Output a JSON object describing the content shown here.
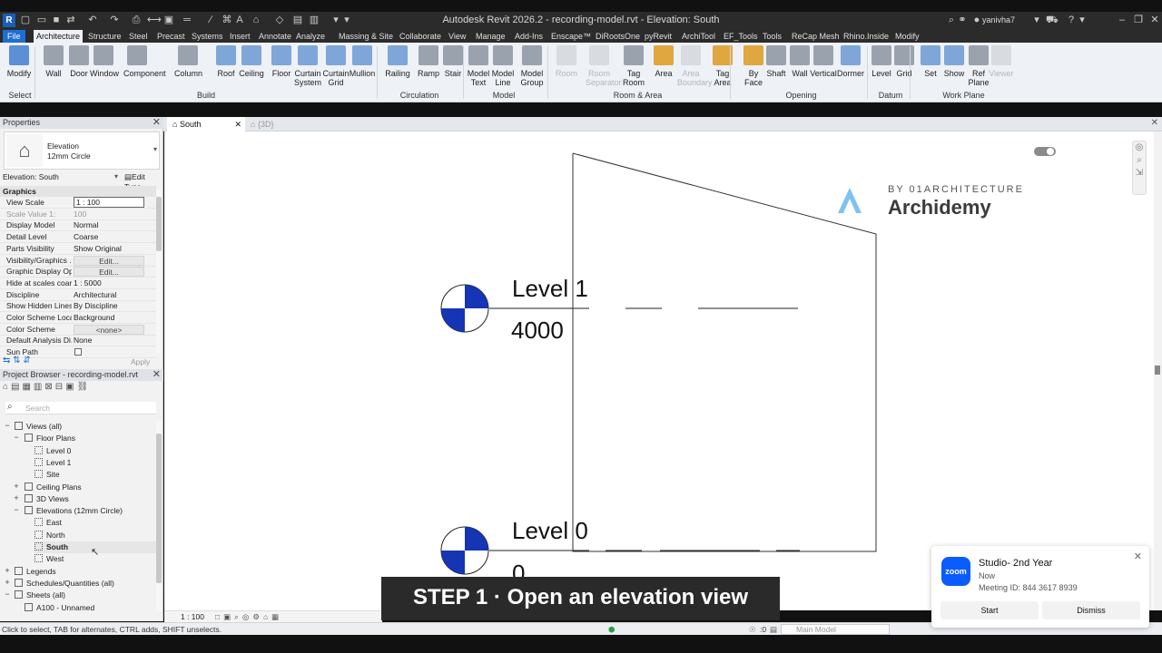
{
  "app": {
    "title": "Autodesk Revit 2026.2 - recording-model.rvt - Elevation: South",
    "user": "yanivha7"
  },
  "menu": [
    "File",
    "Architecture",
    "Structure",
    "Steel",
    "Precast",
    "Systems",
    "Insert",
    "Annotate",
    "Analyze",
    "Massing & Site",
    "Collaborate",
    "View",
    "Manage",
    "Add-Ins",
    "Enscape™",
    "DiRootsOne",
    "pyRevit",
    "ArchiTool",
    "EF_Tools",
    "Tools",
    "ReCap Mesh",
    "Rhino.Inside",
    "Modify"
  ],
  "ribbon": {
    "buttons": [
      {
        "label": "Modify",
        "color": "#5b8fd6"
      },
      {
        "label": "Wall",
        "color": "#9aa2ad"
      },
      {
        "label": "Door",
        "color": "#9aa2ad"
      },
      {
        "label": "Window",
        "color": "#9aa2ad"
      },
      {
        "label": "Component",
        "color": "#9aa2ad"
      },
      {
        "label": "Column",
        "color": "#9aa2ad"
      },
      {
        "label": "Roof",
        "color": "#7fa6d8"
      },
      {
        "label": "Ceiling",
        "color": "#7fa6d8"
      },
      {
        "label": "Floor",
        "color": "#7fa6d8"
      },
      {
        "label": "Curtain\nSystem",
        "color": "#7fa6d8"
      },
      {
        "label": "Curtain\nGrid",
        "color": "#7fa6d8"
      },
      {
        "label": "Mullion",
        "color": "#7fa6d8"
      },
      {
        "label": "Railing",
        "color": "#7fa6d8"
      },
      {
        "label": "Ramp",
        "color": "#9aa2ad"
      },
      {
        "label": "Stair",
        "color": "#9aa2ad"
      },
      {
        "label": "Model\nText",
        "color": "#9aa2ad"
      },
      {
        "label": "Model\nLine",
        "color": "#9aa2ad"
      },
      {
        "label": "Model\nGroup",
        "color": "#9aa2ad"
      },
      {
        "label": "Room",
        "color": "#d8dbe0",
        "dim": true
      },
      {
        "label": "Room\nSeparator",
        "color": "#d8dbe0",
        "dim": true
      },
      {
        "label": "Tag\nRoom",
        "color": "#9aa2ad"
      },
      {
        "label": "Area",
        "color": "#e0a640"
      },
      {
        "label": "Area\nBoundary",
        "color": "#d8dbe0",
        "dim": true
      },
      {
        "label": "Tag\nArea",
        "color": "#e0a640"
      },
      {
        "label": "By\nFace",
        "color": "#e0a640"
      },
      {
        "label": "Shaft",
        "color": "#9aa2ad"
      },
      {
        "label": "Wall",
        "color": "#9aa2ad"
      },
      {
        "label": "Vertical",
        "color": "#9aa2ad"
      },
      {
        "label": "Dormer",
        "color": "#7fa6d8"
      },
      {
        "label": "Level",
        "color": "#9aa2ad"
      },
      {
        "label": "Grid",
        "color": "#9aa2ad"
      },
      {
        "label": "Set",
        "color": "#7fa6d8"
      },
      {
        "label": "Show",
        "color": "#7fa6d8"
      },
      {
        "label": "Ref\nPlane",
        "color": "#9aa2ad"
      },
      {
        "label": "Viewer",
        "color": "#d8dbe0",
        "dim": true
      }
    ],
    "groups": [
      "Select",
      "Build",
      "Circulation",
      "Model",
      "Room & Area",
      "Opening",
      "Datum",
      "Work Plane"
    ]
  },
  "properties": {
    "header": "Properties",
    "type_name": "Elevation",
    "type_sub": "12mm Circle",
    "selector": "Elevation: South",
    "edit_type": "Edit Type",
    "section": "Graphics",
    "rows": [
      {
        "k": "View Scale",
        "v": "1 : 100",
        "kind": "box"
      },
      {
        "k": "Scale Value    1:",
        "v": "100",
        "kind": "dim"
      },
      {
        "k": "Display Model",
        "v": "Normal"
      },
      {
        "k": "Detail Level",
        "v": "Coarse"
      },
      {
        "k": "Parts Visibility",
        "v": "Show Original"
      },
      {
        "k": "Visibility/Graphics ...",
        "v": "Edit...",
        "kind": "btn"
      },
      {
        "k": "Graphic Display Op...",
        "v": "Edit...",
        "kind": "btn"
      },
      {
        "k": "Hide at scales coar...",
        "v": "1 : 5000"
      },
      {
        "k": "Discipline",
        "v": "Architectural"
      },
      {
        "k": "Show Hidden Lines",
        "v": "By Discipline"
      },
      {
        "k": "Color Scheme Loca...",
        "v": "Background"
      },
      {
        "k": "Color Scheme",
        "v": "<none>",
        "kind": "btn"
      },
      {
        "k": "Default Analysis Di...",
        "v": "None"
      },
      {
        "k": "Sun Path",
        "v": "",
        "kind": "check"
      }
    ],
    "apply": "Apply"
  },
  "browser": {
    "header": "Project Browser - recording-model.rvt",
    "search_placeholder": "Search",
    "items": [
      {
        "label": "Views (all)",
        "level": 0,
        "pm": "−"
      },
      {
        "label": "Floor Plans",
        "level": 1,
        "pm": "−"
      },
      {
        "label": "Level 0",
        "level": 2,
        "view": true
      },
      {
        "label": "Level 1",
        "level": 2,
        "view": true
      },
      {
        "label": "Site",
        "level": 2,
        "view": true
      },
      {
        "label": "Ceiling Plans",
        "level": 1,
        "pm": "+"
      },
      {
        "label": "3D Views",
        "level": 1,
        "pm": "+"
      },
      {
        "label": "Elevations (12mm Circle)",
        "level": 1,
        "pm": "−"
      },
      {
        "label": "East",
        "level": 2,
        "view": true
      },
      {
        "label": "North",
        "level": 2,
        "view": true
      },
      {
        "label": "South",
        "level": 2,
        "view": true,
        "selected": true
      },
      {
        "label": "West",
        "level": 2,
        "view": true
      },
      {
        "label": "Legends",
        "level": 0,
        "pm": "+"
      },
      {
        "label": "Schedules/Quantities (all)",
        "level": 0,
        "pm": "+"
      },
      {
        "label": "Sheets (all)",
        "level": 0,
        "pm": "−"
      },
      {
        "label": "A100 - Unnamed",
        "level": 1
      }
    ]
  },
  "tabs": [
    {
      "label": "South",
      "active": true
    },
    {
      "label": "{3D}",
      "active": false
    }
  ],
  "canvas": {
    "levels": [
      {
        "name": "Level 1",
        "elev": "4000"
      },
      {
        "name": "Level 0",
        "elev": "0"
      }
    ],
    "watermark_small": "BY 01ARCHITECTURE",
    "watermark_big": "Archidemy"
  },
  "view_scale": "1 : 100",
  "status": {
    "hint": "Click to select, TAB for alternates, CTRL adds, SHIFT unselects.",
    "model": "Main Model",
    "zero": ":0"
  },
  "overlay": {
    "step": "STEP 1  ·  Open an elevation view"
  },
  "zoom_card": {
    "title": "Studio- 2nd Year",
    "when": "Now",
    "meeting": "Meeting ID: 844 3617 8939",
    "start": "Start",
    "dismiss": "Dismiss"
  },
  "colors": {
    "accent": "#1d6fd1",
    "level_head": "#1535b5"
  }
}
